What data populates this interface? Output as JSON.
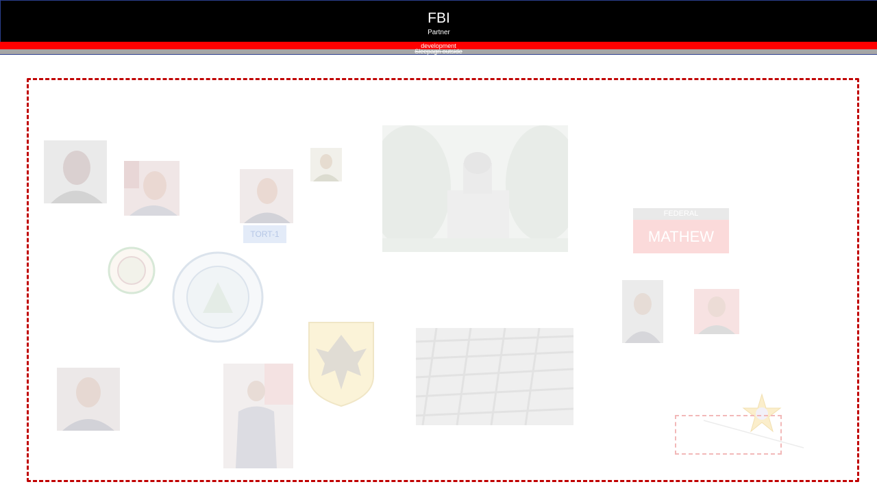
{
  "header": {
    "title": "FBI",
    "subtitle": "Partner"
  },
  "red_bar": {
    "label": "development"
  },
  "gray_bar": {
    "label": "Sleepagn outside"
  },
  "board": {
    "tag_label": "TORT-1",
    "card": {
      "header": "FEDERAL",
      "name": "MATHEW"
    }
  },
  "colors": {
    "header_bg": "#000000",
    "red_bar": "#ff0000",
    "gray_bar": "#a6a6a6",
    "frame_border": "#c00000"
  }
}
